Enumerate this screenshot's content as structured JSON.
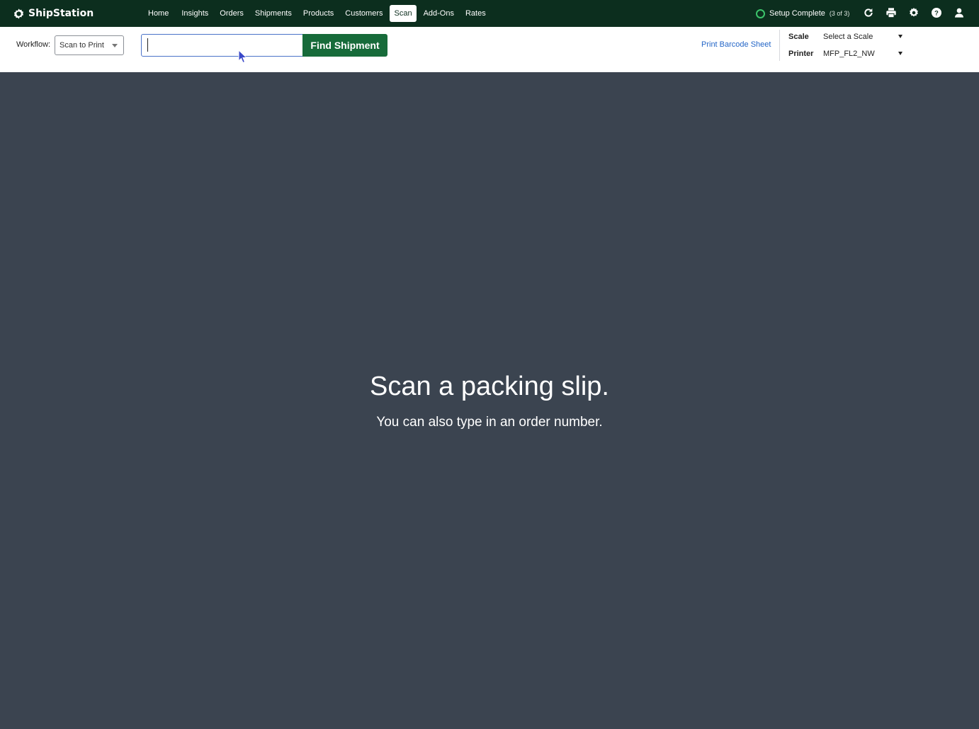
{
  "app": {
    "logo_text": "ShipStation"
  },
  "nav": {
    "items": [
      {
        "label": "Home"
      },
      {
        "label": "Insights"
      },
      {
        "label": "Orders"
      },
      {
        "label": "Shipments"
      },
      {
        "label": "Products"
      },
      {
        "label": "Customers"
      },
      {
        "label": "Scan",
        "active": true
      },
      {
        "label": "Add-Ons"
      },
      {
        "label": "Rates"
      }
    ]
  },
  "setup": {
    "label": "Setup Complete",
    "count": "(3 of 3)",
    "status_color": "#3cc46b"
  },
  "top_icons": [
    "refresh-icon",
    "printer-icon",
    "gear-icon",
    "help-icon",
    "user-icon"
  ],
  "toolbar": {
    "workflow_label": "Workflow:",
    "workflow_value": "Scan to Print",
    "search_value": "",
    "find_button": "Find Shipment",
    "print_barcode_link": "Print Barcode Sheet",
    "scale_label": "Scale",
    "scale_value": "Select a Scale",
    "printer_label": "Printer",
    "printer_value": "MFP_FL2_NW"
  },
  "main": {
    "title": "Scan a packing slip.",
    "subtitle": "You can also type in an order number."
  },
  "colors": {
    "topbar": "#0c2e1e",
    "accent": "#176b3a",
    "link": "#2466c7",
    "background": "#3b4450"
  }
}
